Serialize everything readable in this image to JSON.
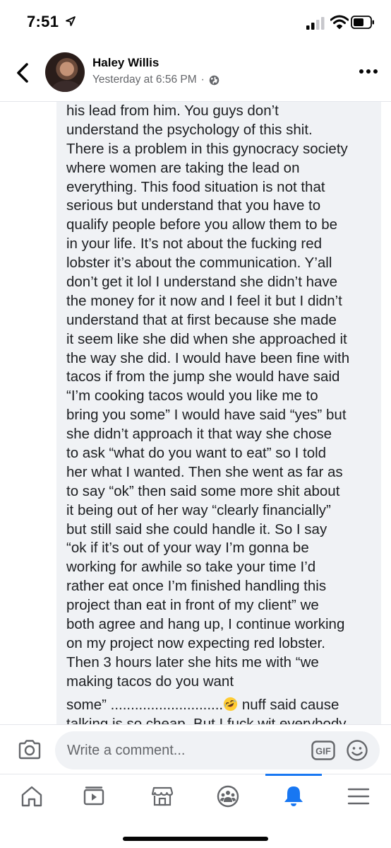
{
  "status_bar": {
    "time": "7:51"
  },
  "header": {
    "author": "Haley Willis",
    "timestamp": "Yesterday at 6:56 PM",
    "separator": "·",
    "icons": [
      "back-chevron-icon",
      "globe-icon",
      "more-icon"
    ]
  },
  "comment": {
    "lines": [
      "his lead from him.  You guys don’t",
      "understand the psychology of this shit.",
      "There is a problem in this gynocracy society",
      "where women are taking the lead on",
      "everything. This food situation is not that",
      "serious but understand that you have to",
      "qualify people before you allow them to be",
      "in your life. It’s not about the fucking red",
      "lobster it’s about the communication. Y’all",
      "don’t get it lol I understand she didn’t have",
      "the money for it now and I feel it but I didn’t",
      "understand that at first because she made",
      "it seem like she did when she approached it",
      "the way she did. I would have been fine with",
      "tacos if from the jump she would have said",
      "“I’m cooking tacos would you like me to",
      "bring you some” I would have said “yes” but",
      "she didn’t approach it that way she chose",
      "to ask “what do you want to eat” so I told",
      "her what I wanted.  Then she went as far as",
      "to say “ok” then said some more shit about",
      "it being out of her way “clearly financially”",
      "but still said she could handle it. So I say",
      "“ok if it’s out of your way I’m gonna be",
      "working for awhile so take your time I’d",
      "rather eat once I’m finished handling this",
      "project than eat in front of my client” we",
      "both agree and hang up, I continue working",
      "on my project now expecting red lobster.",
      "Then 3 hours later she hits me with “we",
      "making tacos do you want"
    ],
    "line_emoji_before": "some” ............................",
    "line_emoji_after": " nuff said cause",
    "last_line": "talking is so cheap. But I fuck wit everybody",
    "emoji": "rolling-on-floor-laughing-emoji"
  },
  "composer": {
    "placeholder": "Write a comment...",
    "gif_label": "GIF",
    "icons": [
      "camera-icon",
      "gif-icon",
      "smiley-icon"
    ]
  },
  "bottom_nav": {
    "items": [
      "home",
      "watch",
      "marketplace",
      "groups",
      "notifications",
      "menu"
    ],
    "active": "notifications",
    "accent_color": "#1877f2"
  },
  "colors": {
    "bubble": "#f0f2f5",
    "secondary_text": "#65676b",
    "accent": "#1877f2"
  }
}
